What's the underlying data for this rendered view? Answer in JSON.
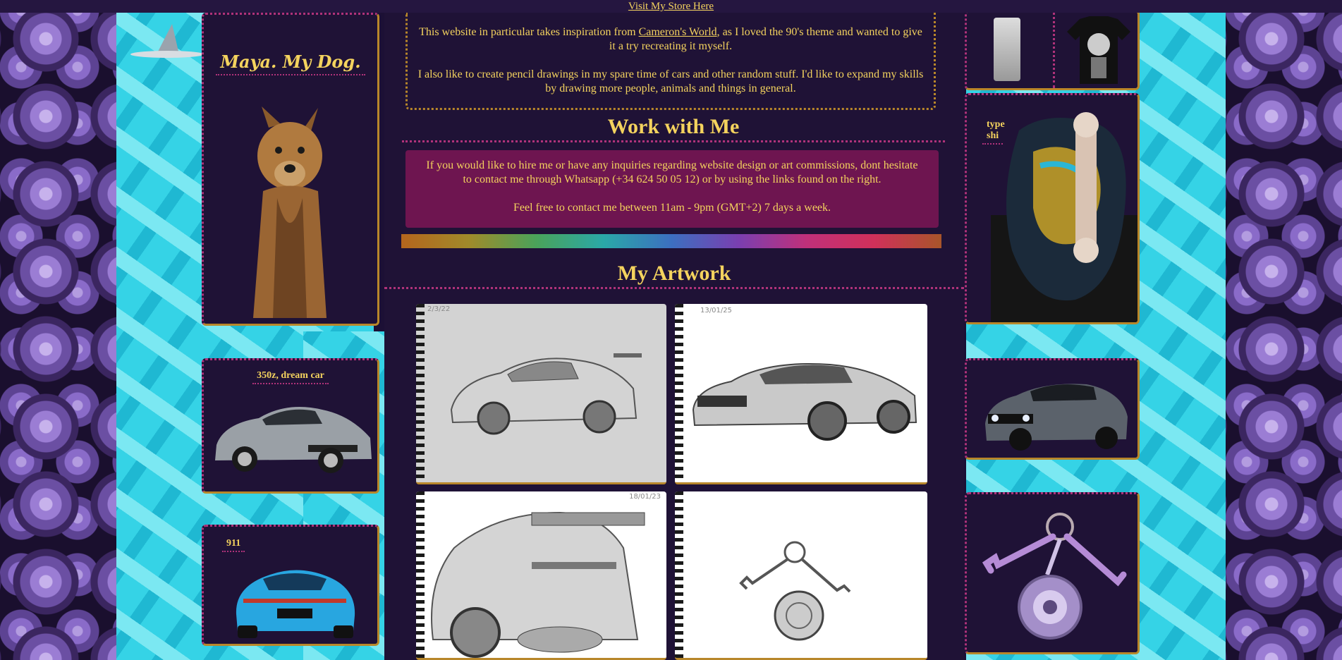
{
  "topbar": {
    "store_link": "Visit My Store Here"
  },
  "left": {
    "dog_box": {
      "title": "Maya. My Dog."
    },
    "car1_box": {
      "title": "350z, dream car"
    },
    "car2_box": {
      "title": "911"
    }
  },
  "right": {
    "shop_box": {
      "items": [
        "milk-carton-shirt",
        "skull-tshirt"
      ]
    },
    "skate_box": {
      "title_line1": "type",
      "title_line2": "shi"
    }
  },
  "center": {
    "intro": {
      "p1_before": "This website in particular takes inspiration from ",
      "p1_link": "Cameron's World",
      "p1_after": ", as I loved the 90's theme and wanted to give it a try recreating it myself.",
      "p2": "I also like to create pencil drawings in my spare time of cars and other random stuff. I'd like to expand my skills by drawing more people, animals and things in general."
    },
    "work": {
      "heading": "Work with Me",
      "p1": "If you would like to hire me or have any inquiries regarding website design or art commissions, dont hesitate to contact me through Whatsapp (+34 624 50 05 12) or by using the links found on the right.",
      "p2": "Feel free to contact me between 11am - 9pm (GMT+2) 7 days a week."
    },
    "artwork": {
      "heading": "My Artwork",
      "items": [
        {
          "subject": "350z-sketch",
          "date": "2/3/22"
        },
        {
          "subject": "challenger-sketch",
          "date": "13/01/25"
        },
        {
          "subject": "porsche-sketch",
          "date": "18/01/23"
        },
        {
          "subject": "keys-sketch",
          "date": ""
        }
      ]
    }
  },
  "colors": {
    "text": "#f4d35e",
    "panel": "#1f1236",
    "work_box": "#6e1550",
    "dotted_border": "#b0327a",
    "gold_border": "#b8872a",
    "water": "#35d3e6"
  }
}
